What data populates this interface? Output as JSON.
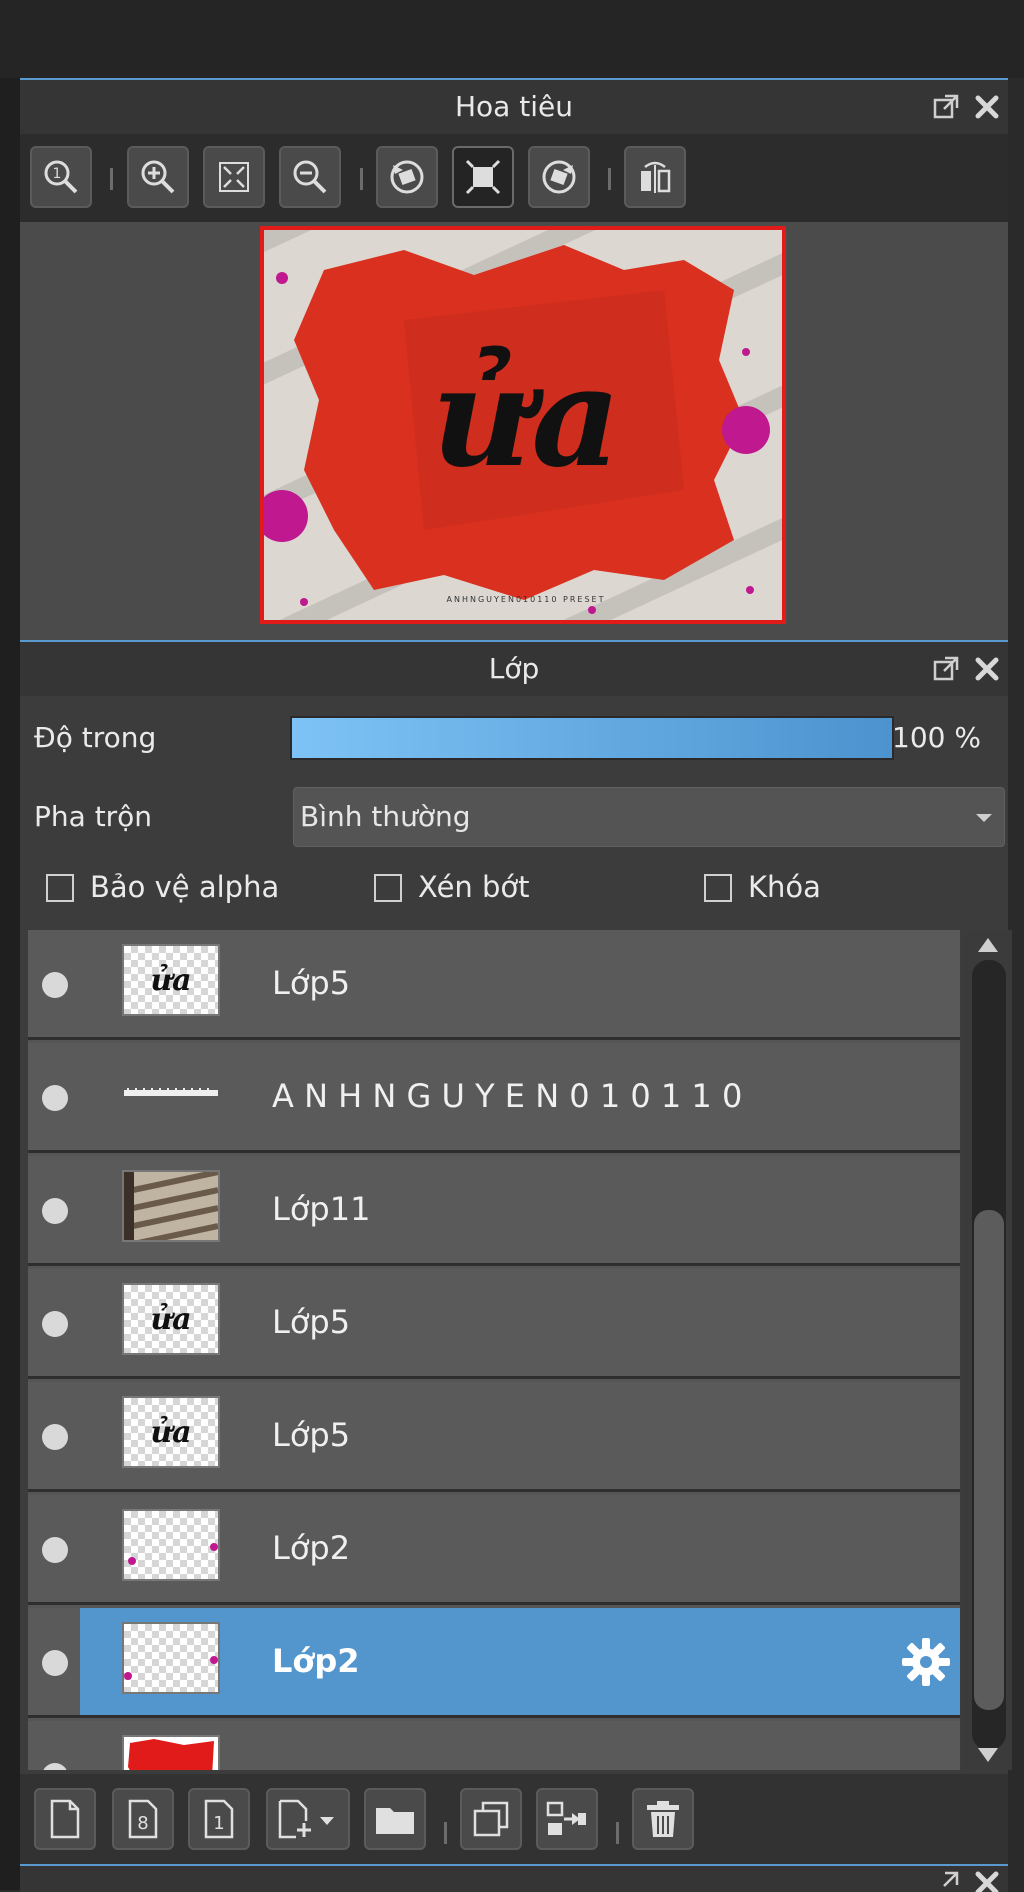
{
  "navigator": {
    "title": "Hoa tiêu",
    "preview_text": "ửa",
    "preview_caption": "ANHNGUYEN010110 PRESET",
    "toolbar_icons": [
      "zoom-actual-icon",
      "zoom-in-icon",
      "fit-screen-icon",
      "zoom-out-icon",
      "rotate-left-icon",
      "fit-window-icon",
      "rotate-right-icon",
      "flip-horizontal-icon"
    ]
  },
  "layers_panel": {
    "title": "Lớp",
    "opacity_label": "Độ trong",
    "opacity_value": "100 %",
    "opacity_fraction": 1.0,
    "blend_label": "Pha trộn",
    "blend_value": "Bình thường",
    "protect_alpha_label": "Bảo vệ alpha",
    "clip_label": "Xén bớt",
    "lock_label": "Khóa",
    "layers": [
      {
        "name": "Lớp5",
        "thumb": "text-ua"
      },
      {
        "name": "A N H N G U Y E N 0 1 0 1 1 0",
        "thumb": "text-line"
      },
      {
        "name": "Lớp11",
        "thumb": "stripes"
      },
      {
        "name": "Lớp5",
        "thumb": "text-ua"
      },
      {
        "name": "Lớp5",
        "thumb": "text-ua"
      },
      {
        "name": "Lớp2",
        "thumb": "dots"
      },
      {
        "name": "Lớp2",
        "thumb": "dots",
        "selected": true
      },
      {
        "name": "",
        "thumb": "red"
      }
    ]
  },
  "colors": {
    "accent": "#5396cd",
    "preview_border": "#e11a1a",
    "paint_red": "#d9301f",
    "magenta": "#c0188f"
  }
}
